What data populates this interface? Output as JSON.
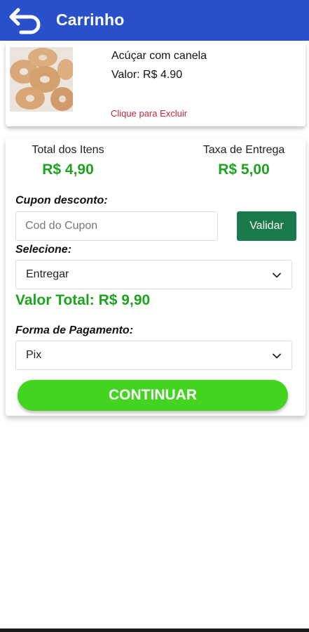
{
  "header": {
    "title": "Carrinho",
    "back_icon": "back-arrow-icon",
    "color": "#2850c8"
  },
  "cart": {
    "items": [
      {
        "name": "Acúçar com canela",
        "price_label": "Valor: R$ 4.90",
        "remove_label": "Clique para Excluir",
        "image": "sugar-donuts-image"
      }
    ]
  },
  "summary": {
    "items_total_label": "Total dos Itens",
    "items_total_value": "R$ 4,90",
    "delivery_fee_label": "Taxa de Entrega",
    "delivery_fee_value": "R$ 5,00",
    "coupon_label": "Cupon desconto:",
    "coupon_placeholder": "Cod do Cupon",
    "coupon_value": "",
    "validate_label": "Validar",
    "delivery_select_label": "Selecione:",
    "delivery_select_value": "Entregar",
    "grand_total": "Valor Total: R$ 9,90",
    "payment_label": "Forma de Pagamento:",
    "payment_select_value": "Pix",
    "continue_label": "CONTINUAR"
  },
  "colors": {
    "accent_green": "#1ca41e",
    "continue_green": "#42d41e",
    "validate_green": "#1a7a4c",
    "remove_red": "#c3283c"
  }
}
